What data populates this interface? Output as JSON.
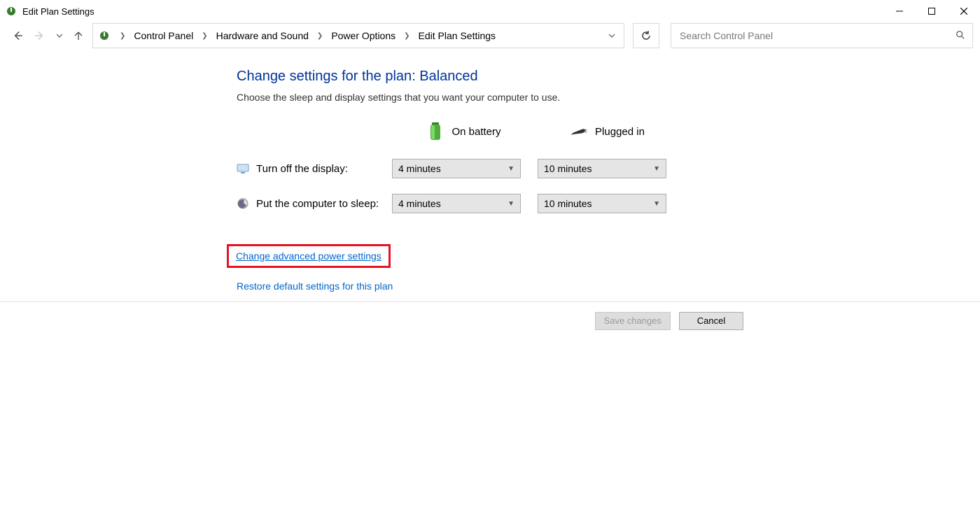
{
  "window": {
    "title": "Edit Plan Settings"
  },
  "breadcrumb": {
    "items": [
      "Control Panel",
      "Hardware and Sound",
      "Power Options",
      "Edit Plan Settings"
    ]
  },
  "search": {
    "placeholder": "Search Control Panel"
  },
  "page": {
    "heading": "Change settings for the plan: Balanced",
    "subtext": "Choose the sleep and display settings that you want your computer to use.",
    "col_battery": "On battery",
    "col_plugged": "Plugged in",
    "row_display": "Turn off the display:",
    "row_sleep": "Put the computer to sleep:",
    "display_battery": "4 minutes",
    "display_plugged": "10 minutes",
    "sleep_battery": "4 minutes",
    "sleep_plugged": "10 minutes",
    "advanced_link": "Change advanced power settings",
    "restore_link": "Restore default settings for this plan"
  },
  "footer": {
    "save": "Save changes",
    "cancel": "Cancel"
  }
}
